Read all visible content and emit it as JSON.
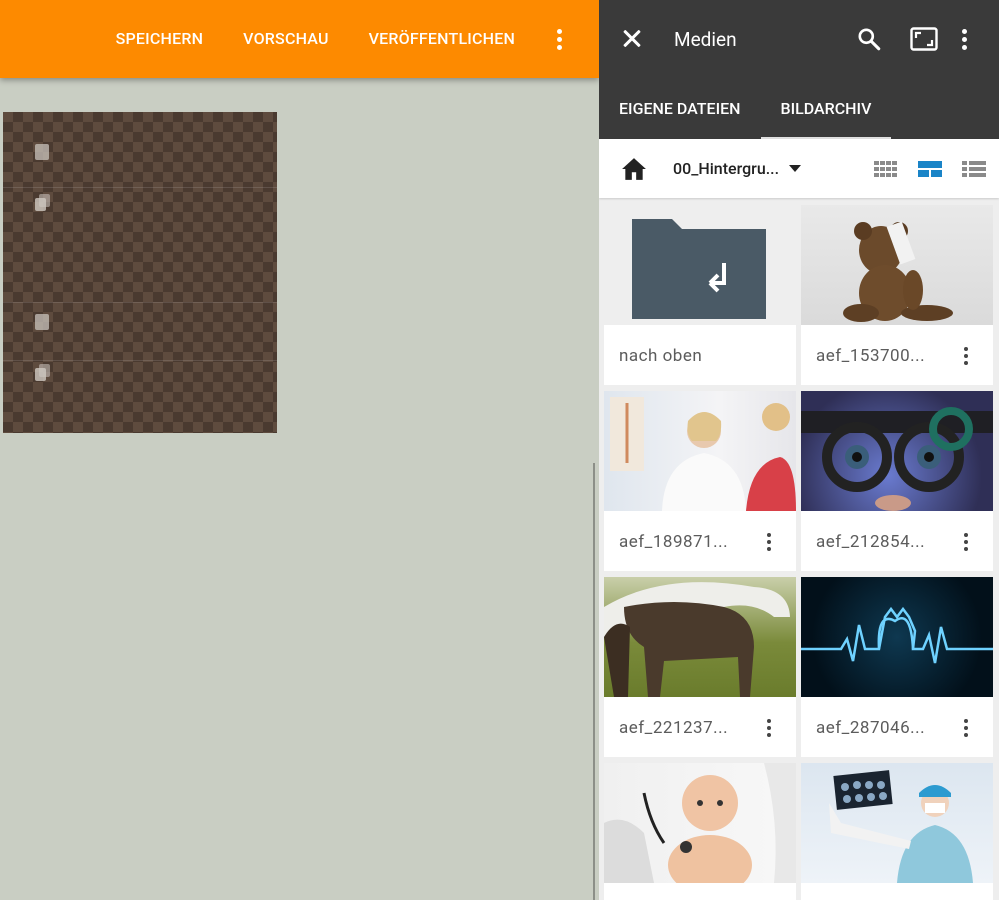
{
  "editor": {
    "toolbar": {
      "save_label": "SPEICHERN",
      "preview_label": "VORSCHAU",
      "publish_label": "VERÖFFENTLICHEN",
      "more_icon": "more-vert-icon"
    },
    "accent_color": "#fd8a00"
  },
  "media_panel": {
    "title": "Medien",
    "icons": [
      "close-icon",
      "search-icon",
      "fullscreen-icon",
      "more-vert-icon"
    ],
    "tabs": [
      {
        "label": "EIGENE DATEIEN",
        "active": false
      },
      {
        "label": "BILDARCHIV",
        "active": true
      }
    ],
    "toolbar": {
      "folder": "00_Hintergru...",
      "views": [
        "grid-small-icon",
        "grid-large-icon",
        "list-icon"
      ],
      "active_view": "grid-large-icon"
    },
    "items": [
      {
        "name": "nach oben",
        "type": "folder-up"
      },
      {
        "name": "aef_153700...",
        "type": "image",
        "subject": "teddy bear"
      },
      {
        "name": "aef_189871...",
        "type": "image",
        "subject": "doctor with patient"
      },
      {
        "name": "aef_212854...",
        "type": "image",
        "subject": "eye exam"
      },
      {
        "name": "aef_221237...",
        "type": "image",
        "subject": "horses"
      },
      {
        "name": "aef_287046...",
        "type": "image",
        "subject": "heartbeat line"
      },
      {
        "name": "",
        "type": "image",
        "subject": "baby with stethoscope"
      },
      {
        "name": "",
        "type": "image",
        "subject": "doctor with x-ray"
      }
    ],
    "header_color": "#3a3a3a",
    "view_active_color": "#1a84c7"
  }
}
